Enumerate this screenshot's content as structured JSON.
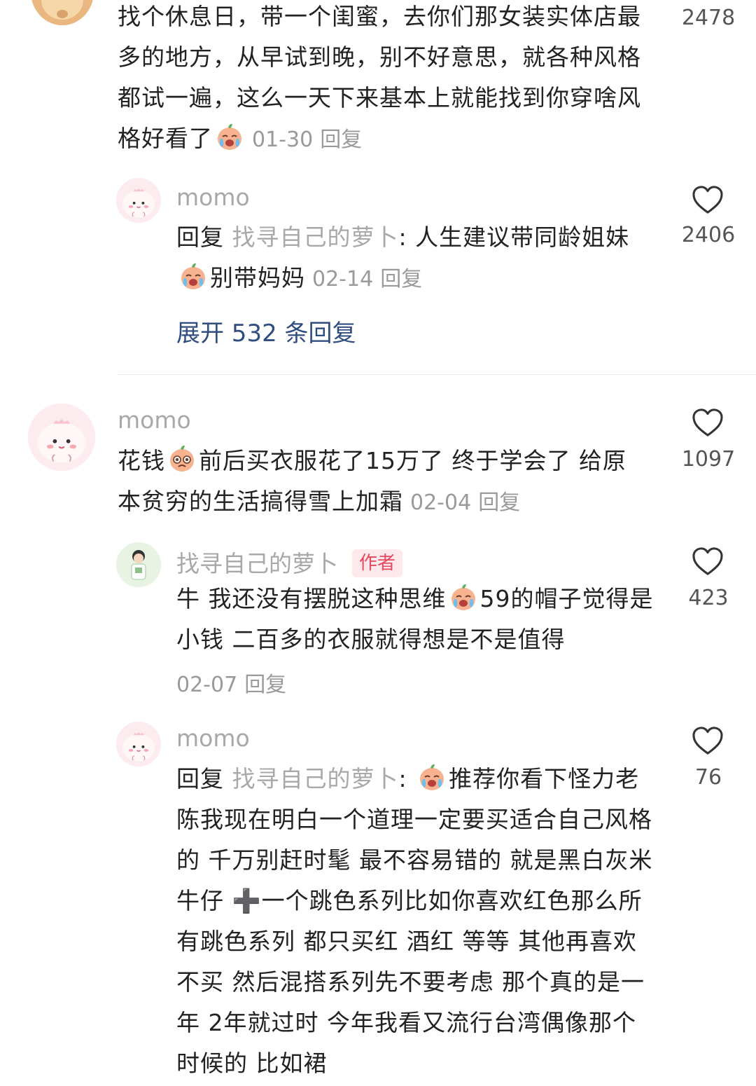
{
  "comment_1": {
    "text": "找个休息日，带一个闺蜜，去你们那女装实体店最多的地方，从早试到晚，别不好意思，就各种风格都试一遍，这么一天下来基本上就能找到你穿啥风格好看了",
    "emoji": "crying-face-emoji",
    "date": "01-30",
    "reply_label": "回复",
    "likes": "2478",
    "reply": {
      "username": "momo",
      "reply_prefix": "回复",
      "reply_to": "找寻自己的萝卜",
      "text_part1": "人生建议带同龄姐妹",
      "emoji": "crying-face-emoji",
      "text_part2": "别带妈妈",
      "date": "02-14",
      "reply_label": "回复",
      "likes": "2406"
    },
    "expand_label": "展开 532 条回复"
  },
  "comment_2": {
    "username": "momo",
    "text_part1": "花钱",
    "emoji": "pleading-face-emoji",
    "text_part2": "前后买衣服花了15万了 终于学会了 给原本贫穷的生活搞得雪上加霜",
    "date": "02-04",
    "reply_label": "回复",
    "likes": "1097",
    "replies": [
      {
        "username": "找寻自己的萝卜",
        "badge": "作者",
        "text_part1": "牛 我还没有摆脱这种思维",
        "emoji": "crying-face-emoji",
        "text_part2": "59的帽子觉得是小钱 二百多的衣服就得想是不是值得",
        "date": "02-07",
        "reply_label": "回复",
        "likes": "423"
      },
      {
        "username": "momo",
        "reply_prefix": "回复",
        "reply_to": "找寻自己的萝卜",
        "emoji": "crying-face-emoji",
        "text": "推荐你看下怪力老陈我现在明白一个道理一定要买适合自己风格的 千万别赶时髦 最不容易错的 就是黑白灰米牛仔 ➕一个跳色系列比如你喜欢红色那么所有跳色系列 都只买红 酒红 等等 其他再喜欢不买 然后混搭系列先不要考虑 那个真的是一年 2年就过时 今年我看又流行台湾偶像那个时候的 比如裙",
        "likes": "76"
      }
    ]
  }
}
